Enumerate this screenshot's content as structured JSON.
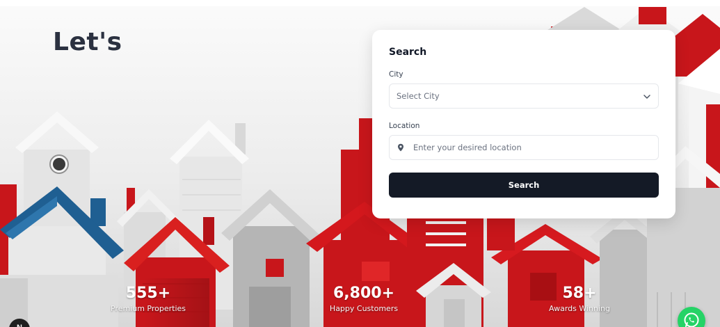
{
  "hero": {
    "headline": "Let's"
  },
  "search_card": {
    "title": "Search",
    "city_label": "City",
    "city_value": "Select City",
    "location_label": "Location",
    "location_placeholder": "Enter your desired location",
    "search_button": "Search"
  },
  "stats": [
    {
      "value": "555+",
      "label": "Premium Properties"
    },
    {
      "value": "6,800+",
      "label": "Happy Customers"
    },
    {
      "value": "58+",
      "label": "Awards Winning"
    }
  ],
  "floating": {
    "badge_letter": "N"
  },
  "icons": {
    "city_dropdown": "chevron-down-icon",
    "location_field": "map-pin-icon",
    "chat_button": "whatsapp-icon"
  },
  "colors": {
    "primary_button": "#141a26",
    "headline": "#2b3140",
    "house_red": "#c8161b",
    "house_blue": "#1f5f92",
    "whatsapp": "#25d366"
  }
}
